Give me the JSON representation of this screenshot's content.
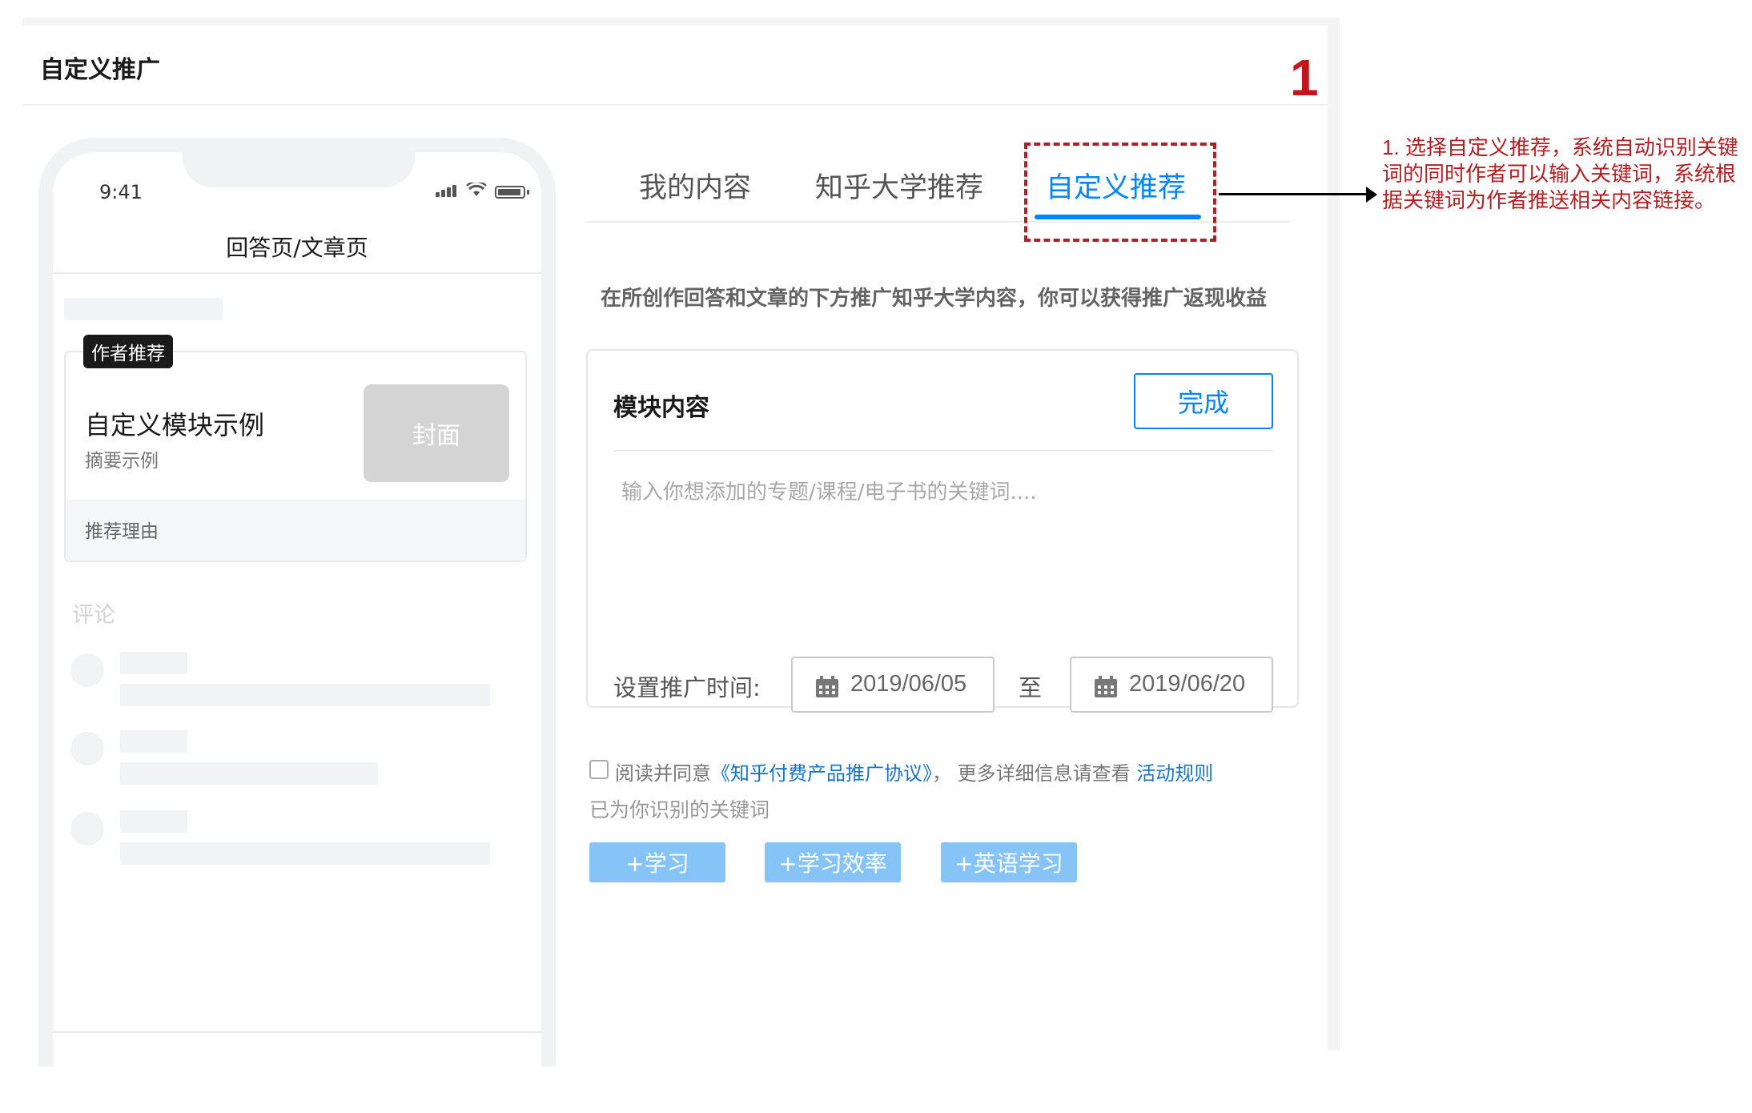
{
  "panel": {
    "title": "自定义推广",
    "step_number": "1"
  },
  "phone": {
    "time": "9:41",
    "page_title": "回答页/文章页",
    "card": {
      "tag": "作者推荐",
      "title": "自定义模块示例",
      "summary": "摘要示例",
      "cover": "封面",
      "reason": "推荐理由"
    },
    "comments_label": "评论"
  },
  "tabs": [
    {
      "label": "我的内容",
      "active": false
    },
    {
      "label": "知乎大学推荐",
      "active": false
    },
    {
      "label": "自定义推荐",
      "active": true
    }
  ],
  "description": "在所创作回答和文章的下方推广知乎大学内容，你可以获得推广返现收益",
  "module": {
    "title": "模块内容",
    "done_label": "完成",
    "input_placeholder": "输入你想添加的专题/课程/电子书的关键词....",
    "input_value": "",
    "time_label": "设置推广时间:",
    "start_date": "2019/06/05",
    "to_label": "至",
    "end_date": "2019/06/20"
  },
  "agreement": {
    "prefix": "阅读并同意",
    "link": "《知乎付费产品推广协议》",
    "middle": "，  更多详细信息请查看",
    "rules_link": "活动规则",
    "checked": false
  },
  "recognized_label": "已为你识别的关键词",
  "keywords": [
    "+学习",
    "+学习效率",
    "+英语学习"
  ],
  "annotation": "1. 选择自定义推荐，系统自动识别关键词的同时作者可以输入关键词，系统根据关键词为作者推送相关内容链接。",
  "colors": {
    "accent": "#0084ff",
    "annotation_red": "#b32024",
    "keyword_bg": "#86c3f7",
    "link": "#1a73c8"
  }
}
